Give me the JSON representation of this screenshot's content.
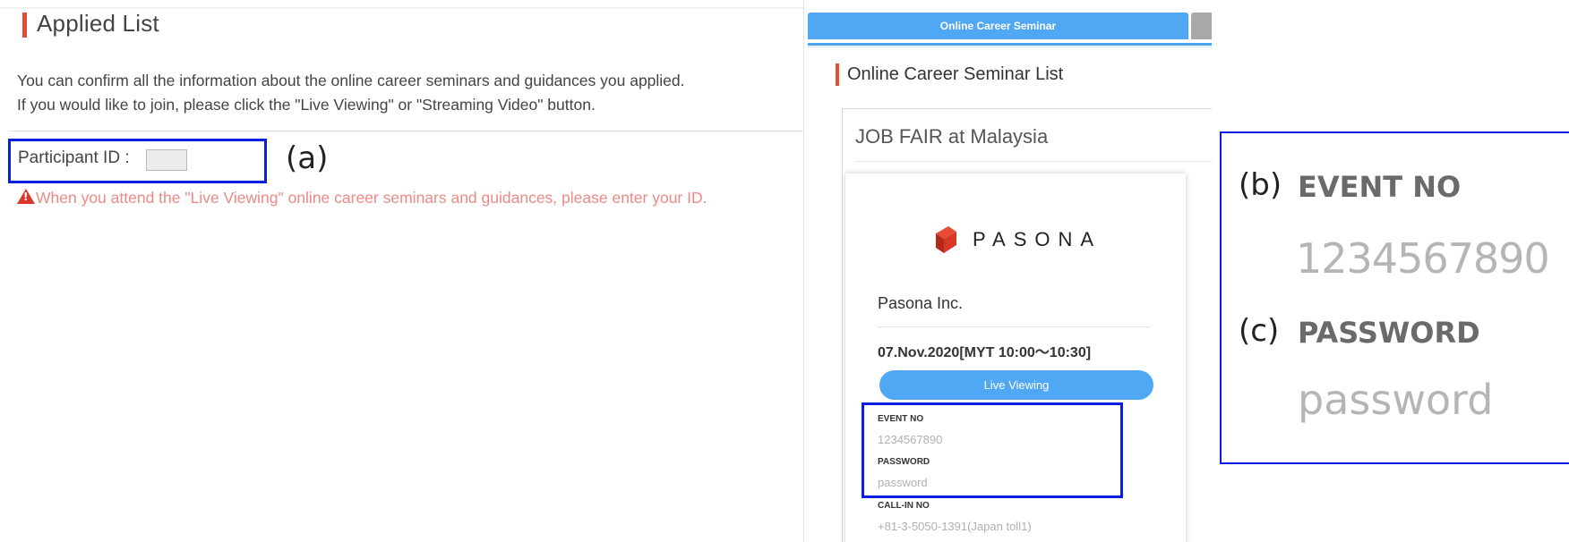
{
  "applied_list": {
    "title": "Applied List",
    "intro_line1": "You can confirm all the information about the online career seminars and guidances you applied.",
    "intro_line2": "If you would like to join, please click the \"Live Viewing\" or \"Streaming Video\" button.",
    "participant_id_label": "Participant ID :",
    "participant_id_value": "",
    "warning_icon": "warning-triangle-icon",
    "warning_text": "When you attend the \"Live Viewing\" online career seminars and guidances, please enter your ID."
  },
  "annotations": {
    "a": "(a)",
    "b": "(b)",
    "c": "(c)"
  },
  "seminar_page": {
    "tab_active": "Online Career Seminar",
    "list_title": "Online Career Seminar List",
    "job_fair_title": "JOB FAIR at Malaysia",
    "logo_text": "PASONA",
    "company_name": "Pasona Inc.",
    "date_time": "07.Nov.2020[MYT 10:00〜10:30]",
    "live_button": "Live Viewing",
    "event_no_label": "EVENT NO",
    "event_no_value": "1234567890",
    "password_label": "PASSWORD",
    "password_value": "password",
    "callin_label": "CALL-IN NO",
    "callin_value": "+81-3-5050-1391(Japan toll1)"
  },
  "colors": {
    "accent_blue": "#50a8f4",
    "highlight_blue": "#0a1ee0",
    "heading_red": "#e94a35",
    "warning_pink": "#ec8a86"
  }
}
